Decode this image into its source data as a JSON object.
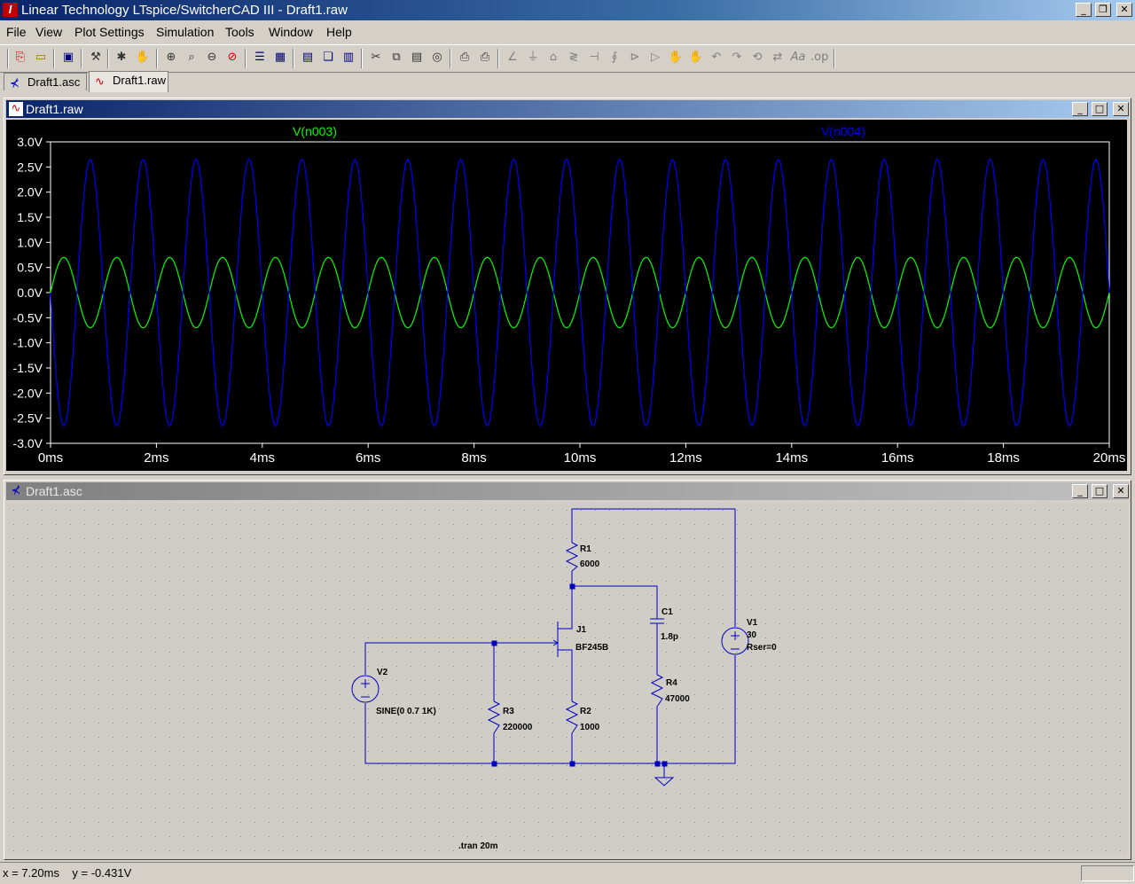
{
  "app": {
    "title": "Linear Technology LTspice/SwitcherCAD III - Draft1.raw",
    "icon": "ltspice-logo-icon",
    "window_buttons": [
      "minimize",
      "restore",
      "close"
    ]
  },
  "menu": [
    "File",
    "View",
    "Plot Settings",
    "Simulation",
    "Tools",
    "Window",
    "Help"
  ],
  "toolbar": {
    "icons": [
      "new-schematic-icon",
      "open-icon",
      "save-icon",
      "control-panel-icon",
      "run-icon",
      "halt-icon",
      "zoom-in-icon",
      "zoom-area-icon",
      "zoom-out-icon",
      "zoom-cancel-icon",
      "autorange-icon",
      "plot-settings-icon",
      "tile-horizontal-icon",
      "cascade-icon",
      "tile-vertical-icon",
      "cut-icon",
      "copy-icon",
      "paste-icon",
      "find-icon",
      "print-preview-icon",
      "print-icon",
      "wire-icon",
      "ground-icon",
      "label-net-icon",
      "resistor-icon",
      "capacitor-icon",
      "inductor-icon",
      "diode-icon",
      "component-icon",
      "move-icon",
      "drag-icon",
      "undo-icon",
      "redo-icon",
      "rotate-icon",
      "mirror-icon",
      "text-icon",
      "spice-directive-icon"
    ]
  },
  "tabs": [
    {
      "label": "Draft1.asc",
      "icon": "schematic-icon"
    },
    {
      "label": "Draft1.raw",
      "icon": "waveform-icon"
    }
  ],
  "waveform_window": {
    "title": "Draft1.raw",
    "icon": "waveform-icon",
    "background": "#000000",
    "grid_color": "#ffffff"
  },
  "chart_data": {
    "type": "line",
    "title": "",
    "xlabel": "",
    "ylabel": "",
    "xlim": [
      0,
      20
    ],
    "ylim": [
      -3.0,
      3.0
    ],
    "x_unit": "ms",
    "y_unit": "V",
    "x_ticks": [
      "0ms",
      "2ms",
      "4ms",
      "6ms",
      "8ms",
      "10ms",
      "12ms",
      "14ms",
      "16ms",
      "18ms",
      "20ms"
    ],
    "y_ticks": [
      "3.0V",
      "2.5V",
      "2.0V",
      "1.5V",
      "1.0V",
      "0.5V",
      "0.0V",
      "-0.5V",
      "-1.0V",
      "-1.5V",
      "-2.0V",
      "-2.5V",
      "-3.0V"
    ],
    "grid": false,
    "legend": "top",
    "series": [
      {
        "name": "V(n003)",
        "color": "#00ff00",
        "waveform": "sine",
        "amplitude": 0.7,
        "frequency_khz": 1,
        "offset": 0,
        "phase": "in-phase"
      },
      {
        "name": "V(n004)",
        "color": "#0000ff",
        "waveform": "sine",
        "amplitude": 2.65,
        "frequency_khz": 1,
        "offset": 0,
        "phase": "inverted"
      }
    ]
  },
  "schematic_window": {
    "title": "Draft1.asc",
    "icon": "schematic-icon",
    "wire_color": "#0000c0",
    "components": [
      {
        "ref": "R1",
        "value": "6000"
      },
      {
        "ref": "C1",
        "value": "1.8p"
      },
      {
        "ref": "J1",
        "value": "BF245B"
      },
      {
        "ref": "V1",
        "value": "30",
        "extra": "Rser=0"
      },
      {
        "ref": "V2",
        "value": "SINE(0 0.7 1K)"
      },
      {
        "ref": "R3",
        "value": "220000"
      },
      {
        "ref": "R2",
        "value": "1000"
      },
      {
        "ref": "R4",
        "value": "47000"
      }
    ],
    "directive": ".tran 20m"
  },
  "status": {
    "text": "x = 7.20ms    y = -0.431V"
  }
}
